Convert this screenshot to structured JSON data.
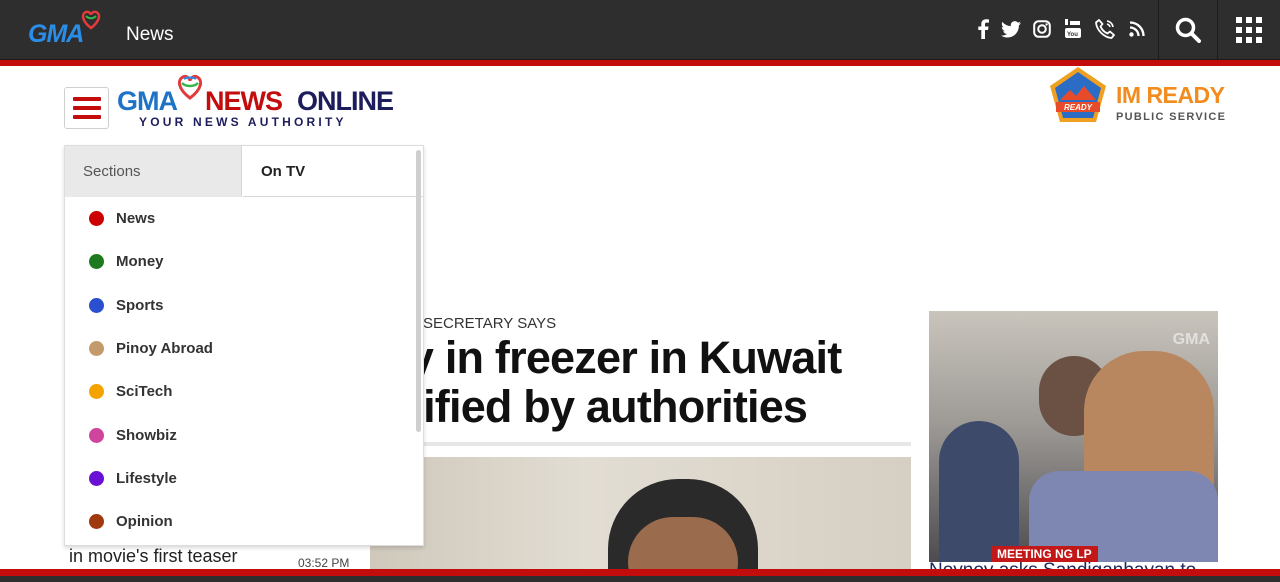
{
  "topbar": {
    "logo_text": "GMA",
    "title": "News",
    "social_icons": [
      "facebook-icon",
      "twitter-icon",
      "instagram-icon",
      "youtube-icon",
      "phone-icon",
      "rss-icon"
    ],
    "search_icon": "search-icon",
    "apps_icon": "grid-apps-icon"
  },
  "brand": {
    "gma": "GMA",
    "news": "NEWS",
    "online": "ONLINE",
    "tagline": "YOUR NEWS AUTHORITY"
  },
  "imready": {
    "title": "IM READY",
    "subtitle": "PUBLIC SERVICE",
    "badge_text": "READY"
  },
  "menu": {
    "tabs": [
      {
        "label": "Sections",
        "active": true
      },
      {
        "label": "On TV",
        "active": false
      }
    ],
    "items": [
      {
        "label": "News",
        "color": "#cc0000"
      },
      {
        "label": "Money",
        "color": "#1e7a1e"
      },
      {
        "label": "Sports",
        "color": "#2a4fcf"
      },
      {
        "label": "Pinoy Abroad",
        "color": "#c49a6c"
      },
      {
        "label": "SciTech",
        "color": "#f5a300"
      },
      {
        "label": "Showbiz",
        "color": "#d0449e"
      },
      {
        "label": "Lifestyle",
        "color": "#6a0fd4"
      },
      {
        "label": "Opinion",
        "color": "#a0390d"
      }
    ]
  },
  "article": {
    "kicker": "SECRETARY SAYS",
    "headline": "nay in freezer in Kuwait entified by authorities"
  },
  "side_story": {
    "watermark": "GMA",
    "lower_third": "MEETING NG LP",
    "caption": "Noynoy asks Sandiganbayan to"
  },
  "left_story": {
    "caption": "in movie's first teaser",
    "time": "03:52 PM"
  }
}
